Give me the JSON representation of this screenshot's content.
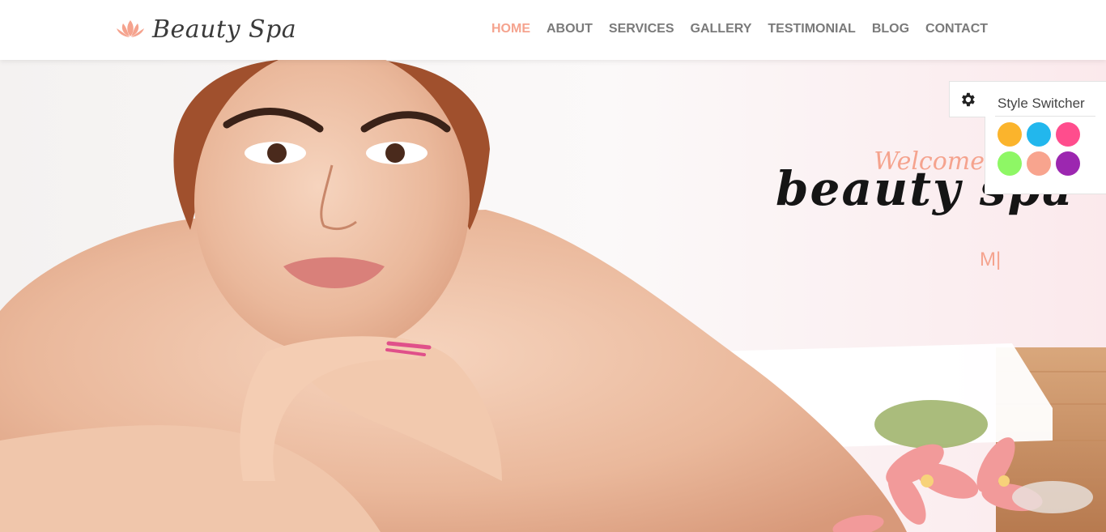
{
  "header": {
    "logo_text": "Beauty Spa",
    "nav": [
      {
        "label": "HOME",
        "active": true
      },
      {
        "label": "ABOUT",
        "active": false
      },
      {
        "label": "SERVICES",
        "active": false
      },
      {
        "label": "GALLERY",
        "active": false
      },
      {
        "label": "TESTIMONIAL",
        "active": false
      },
      {
        "label": "BLOG",
        "active": false
      },
      {
        "label": "CONTACT",
        "active": false
      }
    ]
  },
  "hero": {
    "welcome": "Welcome",
    "brand": "beauty spa",
    "typing_text": "M|"
  },
  "style_switcher": {
    "title": "Style Switcher",
    "colors": [
      "#fbb42c",
      "#22b7ed",
      "#ff4d8d",
      "#8ef765",
      "#f8a48e",
      "#9c27b0"
    ]
  },
  "theme": {
    "accent": "#f5a38e"
  }
}
